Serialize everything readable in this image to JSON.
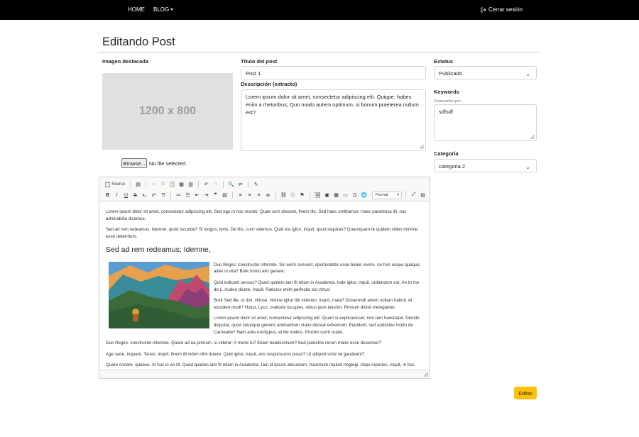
{
  "nav": {
    "home": "HOME",
    "blog": "BLOG",
    "logout": "Cerrar sesión"
  },
  "page": {
    "title": "Editando Post"
  },
  "image": {
    "label": "Imagen destacada",
    "placeholder": "1200 x 800",
    "browse": "Browse...",
    "nofile": "No file selected."
  },
  "post_title": {
    "label": "Título del post",
    "value": "Post 1"
  },
  "description": {
    "label": "Descripción (extracto)",
    "value": "Lorem ipsum dolor sit amet, consectetur adipiscing elit. Quippe: habes enim a rhetoribus; Quo modo autem optimum, si bonum praeterea nullum est?"
  },
  "status": {
    "label": "Estatus",
    "value": "Publicado"
  },
  "keywords": {
    "label": "Keywords",
    "help": "Separadas por ,",
    "value": "sdfsdf"
  },
  "category": {
    "label": "Categoría",
    "value": "categoria 2"
  },
  "editor": {
    "source": "Source",
    "format": "Format",
    "p1": "Lorem ipsum dolor sit amet, consectetur adipiscing elit. Sed ego in hoc resisto; Quae cum dixisset, finem ille. Sed haec omittamus; Haec para/doca illi, nos admirabilia dicamus.",
    "p2": "Sed ad rem redeamus; Idemne, quod iucunde? Si longus, levis; De illis, cum volemus. Quid est igitur, inquit, quod requiras? Quamquam te quidem video minime esse deterritum.",
    "h2": "Sed ad rem redeamus; Idemne,",
    "p3": "Duo Reges: constructio interrete. Sic enim censent, oportunitatis esse beate vivere. An hoc usque quaque, aliter in vita? Bork Immo alio genere;",
    "p4": "Quid iudicant sensus? Quod quidem iam fit etiam in Academia. Inde igitur, inquit, ordiendum est. An tu me de L. Audeo dicere, inquit. Rationis enim perfectio est virtus;",
    "p5": "Bork Sed ille, ut dixi, vitiose. Nonne igitur tibi videntur, inquit, mala? Disserendi artem nullam habuit. At eiusdem modi? Hulus, Lyco, oratione locuples, rebus ipsis ielunior. Primum divisit ineleganter;",
    "p6": "Lorem ipsum dolor sit amet, consectetur adipiscing elit. Quam si explicavisset, non tam haesitaret. Deinde disputat, quod cuiusque generis animantium statui deceat extremum. Equidem, sed audistine modo de Carneade? Nam ante Aristippus, et ille melius. Proclivi currit oratio.",
    "p7": "Duo Reges: constructio interrete. Quare ad ea primum, si videtur; A mene tu? Etiam beatissimum? Sed potestne rerum maior esse dissensio?",
    "p8": "Age sane, inquam. Teneo, inquit, finem illi videri nihil dolere. Quid igitur, inquit, eos responsuros putas? Ut alliquid scire se gaudeant?",
    "p9": "Quare conare, quaeso. At hoc in eo M. Quod quidem iam fit etiam in Academia. Iam id ipsum absurdum, maximum malum neglegi. Atqui reperies, inquit, in hoc quidem pertinacem."
  },
  "submit": {
    "label": "Editar"
  },
  "colors": {
    "navbar": "#000000",
    "submit": "#ffc107"
  }
}
